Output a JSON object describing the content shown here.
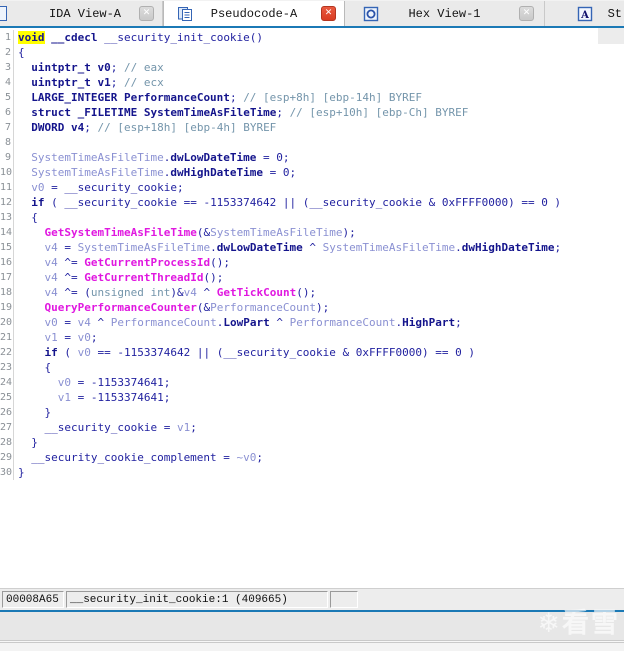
{
  "tabs": {
    "items": [
      {
        "label": "IDA View-A",
        "close": "gray",
        "active": false
      },
      {
        "label": "Pseudocode-A",
        "close": "red",
        "active": true,
        "icon": "pseudocode-icon"
      },
      {
        "label": "Hex View-1",
        "close": "gray",
        "active": false,
        "icon": "hexview-icon"
      },
      {
        "label": "St",
        "close": null,
        "active": false,
        "icon": "structures-icon"
      }
    ],
    "close_glyph": "✕"
  },
  "code": {
    "function_name": "__security_init_cookie",
    "lines": [
      {
        "n": 1,
        "t": [
          [
            "hl",
            "void"
          ],
          [
            "d",
            " "
          ],
          [
            "k",
            "__cdecl"
          ],
          [
            "d",
            " __security_init_cookie()"
          ]
        ]
      },
      {
        "n": 2,
        "t": [
          [
            "d",
            "{"
          ]
        ]
      },
      {
        "n": 3,
        "t": [
          [
            "d",
            "  "
          ],
          [
            "k",
            "uintptr_t"
          ],
          [
            "d",
            " "
          ],
          [
            "k",
            "v0"
          ],
          [
            "d",
            "; "
          ],
          [
            "c",
            "// eax"
          ]
        ]
      },
      {
        "n": 4,
        "t": [
          [
            "d",
            "  "
          ],
          [
            "k",
            "uintptr_t"
          ],
          [
            "d",
            " "
          ],
          [
            "k",
            "v1"
          ],
          [
            "d",
            "; "
          ],
          [
            "c",
            "// ecx"
          ]
        ]
      },
      {
        "n": 5,
        "t": [
          [
            "d",
            "  "
          ],
          [
            "k",
            "LARGE_INTEGER"
          ],
          [
            "d",
            " "
          ],
          [
            "k",
            "PerformanceCount"
          ],
          [
            "d",
            "; "
          ],
          [
            "c",
            "// [esp+8h] [ebp-14h] BYREF"
          ]
        ]
      },
      {
        "n": 6,
        "t": [
          [
            "d",
            "  "
          ],
          [
            "k",
            "struct"
          ],
          [
            "d",
            " "
          ],
          [
            "k",
            "_FILETIME"
          ],
          [
            "d",
            " "
          ],
          [
            "k",
            "SystemTimeAsFileTime"
          ],
          [
            "d",
            "; "
          ],
          [
            "c",
            "// [esp+10h] [ebp-Ch] BYREF"
          ]
        ]
      },
      {
        "n": 7,
        "t": [
          [
            "d",
            "  "
          ],
          [
            "k",
            "DWORD"
          ],
          [
            "d",
            " "
          ],
          [
            "k",
            "v4"
          ],
          [
            "d",
            "; "
          ],
          [
            "c",
            "// [esp+18h] [ebp-4h] BYREF"
          ]
        ]
      },
      {
        "n": 8,
        "t": []
      },
      {
        "n": 9,
        "t": [
          [
            "d",
            "  "
          ],
          [
            "v",
            "SystemTimeAsFileTime"
          ],
          [
            "d",
            "."
          ],
          [
            "k",
            "dwLowDateTime"
          ],
          [
            "d",
            " = 0;"
          ]
        ]
      },
      {
        "n": 10,
        "t": [
          [
            "d",
            "  "
          ],
          [
            "v",
            "SystemTimeAsFileTime"
          ],
          [
            "d",
            "."
          ],
          [
            "k",
            "dwHighDateTime"
          ],
          [
            "d",
            " = 0;"
          ]
        ]
      },
      {
        "n": 11,
        "t": [
          [
            "d",
            "  "
          ],
          [
            "v",
            "v0"
          ],
          [
            "d",
            " = __security_cookie;"
          ]
        ]
      },
      {
        "n": 12,
        "t": [
          [
            "d",
            "  "
          ],
          [
            "k",
            "if"
          ],
          [
            "d",
            " ( __security_cookie == -1153374642 || (__security_cookie & 0xFFFF0000) == 0 )"
          ]
        ]
      },
      {
        "n": 13,
        "t": [
          [
            "d",
            "  {"
          ]
        ]
      },
      {
        "n": 14,
        "t": [
          [
            "d",
            "    "
          ],
          [
            "i",
            "GetSystemTimeAsFileTime"
          ],
          [
            "d",
            "(&"
          ],
          [
            "v",
            "SystemTimeAsFileTime"
          ],
          [
            "d",
            ");"
          ]
        ]
      },
      {
        "n": 15,
        "t": [
          [
            "d",
            "    "
          ],
          [
            "v",
            "v4"
          ],
          [
            "d",
            " = "
          ],
          [
            "v",
            "SystemTimeAsFileTime"
          ],
          [
            "d",
            "."
          ],
          [
            "k",
            "dwLowDateTime"
          ],
          [
            "d",
            " ^ "
          ],
          [
            "v",
            "SystemTimeAsFileTime"
          ],
          [
            "d",
            "."
          ],
          [
            "k",
            "dwHighDateTime"
          ],
          [
            "d",
            ";"
          ]
        ]
      },
      {
        "n": 16,
        "t": [
          [
            "d",
            "    "
          ],
          [
            "v",
            "v4"
          ],
          [
            "d",
            " ^= "
          ],
          [
            "i",
            "GetCurrentProcessId"
          ],
          [
            "d",
            "();"
          ]
        ]
      },
      {
        "n": 17,
        "t": [
          [
            "d",
            "    "
          ],
          [
            "v",
            "v4"
          ],
          [
            "d",
            " ^= "
          ],
          [
            "i",
            "GetCurrentThreadId"
          ],
          [
            "d",
            "();"
          ]
        ]
      },
      {
        "n": 18,
        "t": [
          [
            "d",
            "    "
          ],
          [
            "v",
            "v4"
          ],
          [
            "d",
            " ^= ("
          ],
          [
            "c",
            "unsigned int"
          ],
          [
            "d",
            ")&"
          ],
          [
            "v",
            "v4"
          ],
          [
            "d",
            " ^ "
          ],
          [
            "i",
            "GetTickCount"
          ],
          [
            "d",
            "();"
          ]
        ]
      },
      {
        "n": 19,
        "t": [
          [
            "d",
            "    "
          ],
          [
            "i",
            "QueryPerformanceCounter"
          ],
          [
            "d",
            "(&"
          ],
          [
            "v",
            "PerformanceCount"
          ],
          [
            "d",
            ");"
          ]
        ]
      },
      {
        "n": 20,
        "t": [
          [
            "d",
            "    "
          ],
          [
            "v",
            "v0"
          ],
          [
            "d",
            " = "
          ],
          [
            "v",
            "v4"
          ],
          [
            "d",
            " ^ "
          ],
          [
            "v",
            "PerformanceCount"
          ],
          [
            "d",
            "."
          ],
          [
            "k",
            "LowPart"
          ],
          [
            "d",
            " ^ "
          ],
          [
            "v",
            "PerformanceCount"
          ],
          [
            "d",
            "."
          ],
          [
            "k",
            "HighPart"
          ],
          [
            "d",
            ";"
          ]
        ]
      },
      {
        "n": 21,
        "t": [
          [
            "d",
            "    "
          ],
          [
            "v",
            "v1"
          ],
          [
            "d",
            " = "
          ],
          [
            "v",
            "v0"
          ],
          [
            "d",
            ";"
          ]
        ]
      },
      {
        "n": 22,
        "t": [
          [
            "d",
            "    "
          ],
          [
            "k",
            "if"
          ],
          [
            "d",
            " ( "
          ],
          [
            "v",
            "v0"
          ],
          [
            "d",
            " == -1153374642 || (__security_cookie & 0xFFFF0000) == 0 )"
          ]
        ]
      },
      {
        "n": 23,
        "t": [
          [
            "d",
            "    {"
          ]
        ]
      },
      {
        "n": 24,
        "t": [
          [
            "d",
            "      "
          ],
          [
            "v",
            "v0"
          ],
          [
            "d",
            " = -1153374641;"
          ]
        ]
      },
      {
        "n": 25,
        "t": [
          [
            "d",
            "      "
          ],
          [
            "v",
            "v1"
          ],
          [
            "d",
            " = -1153374641;"
          ]
        ]
      },
      {
        "n": 26,
        "t": [
          [
            "d",
            "    }"
          ]
        ]
      },
      {
        "n": 27,
        "t": [
          [
            "d",
            "    __security_cookie = "
          ],
          [
            "v",
            "v1"
          ],
          [
            "d",
            ";"
          ]
        ]
      },
      {
        "n": 28,
        "t": [
          [
            "d",
            "  }"
          ]
        ]
      },
      {
        "n": 29,
        "t": [
          [
            "d",
            "  __security_cookie_complement = "
          ],
          [
            "v",
            "~v0"
          ],
          [
            "d",
            ";"
          ]
        ]
      },
      {
        "n": 30,
        "t": [
          [
            "d",
            "}"
          ]
        ]
      }
    ]
  },
  "status": {
    "address": "00008A65",
    "location": "__security_init_cookie:1 (409665)"
  },
  "watermark": "❄看雪",
  "colors": {
    "accent_blue_line": "#1b79b5",
    "tab_bg": "#eaeaea",
    "active_tab_bg": "#ffffff",
    "close_red": "#d93c22",
    "keyword": "#14148c",
    "default_text": "#2222a0",
    "local_var": "#8a90d2",
    "imported_func": "#e018e0",
    "comment": "#7495ab",
    "highlight_bg": "#ffff00"
  }
}
